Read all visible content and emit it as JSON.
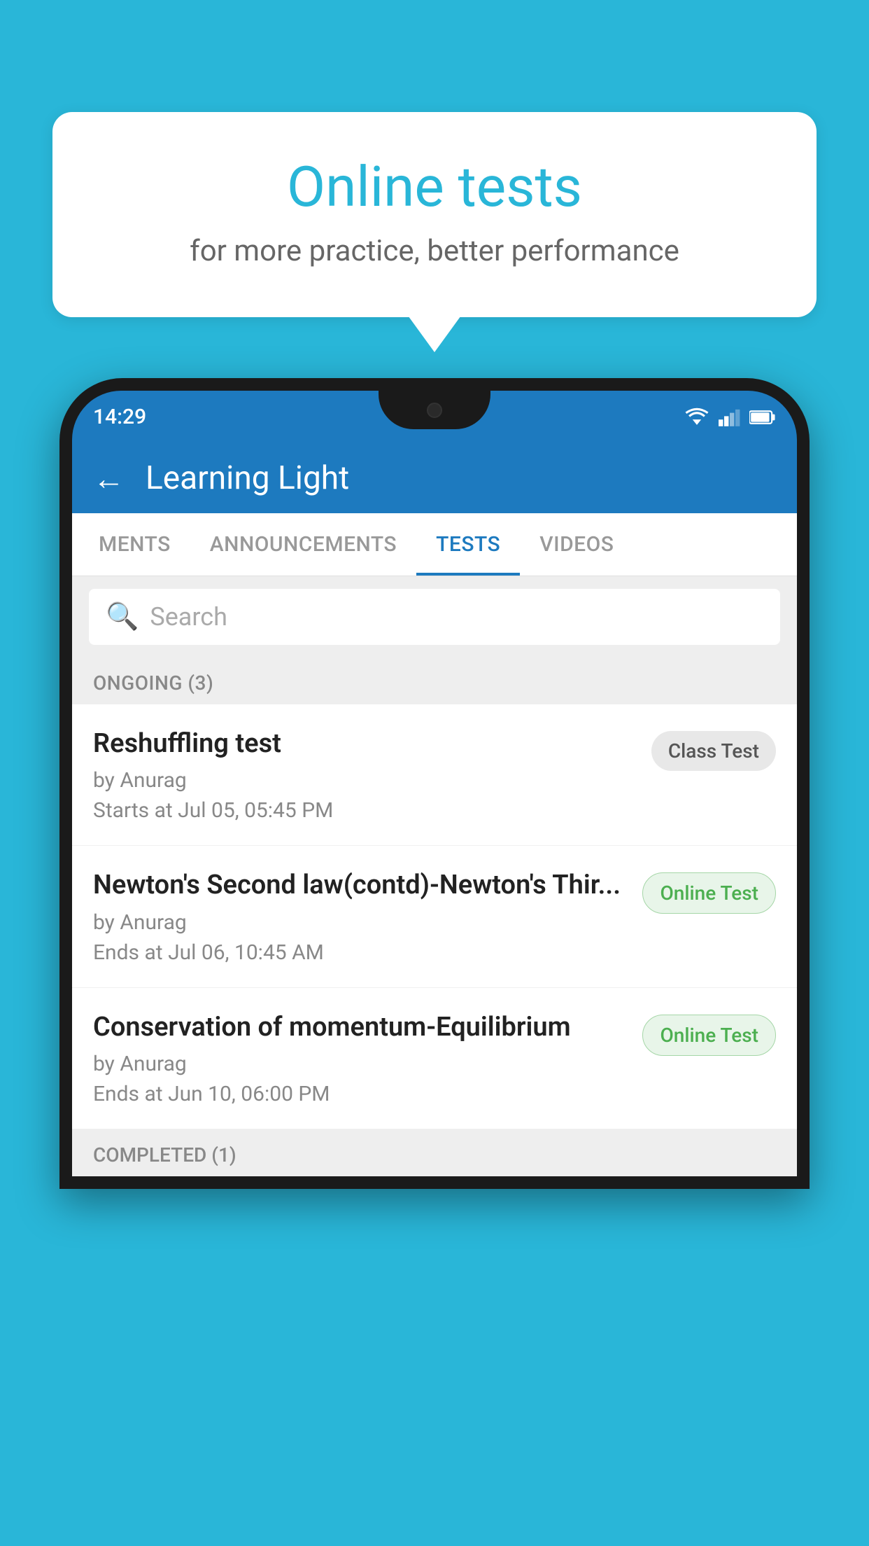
{
  "background_color": "#29b6d8",
  "bubble": {
    "title": "Online tests",
    "subtitle": "for more practice, better performance"
  },
  "phone": {
    "status_bar": {
      "time": "14:29",
      "signal_icon": "signal",
      "battery_icon": "battery"
    },
    "header": {
      "back_label": "←",
      "title": "Learning Light"
    },
    "tabs": [
      {
        "label": "MENTS",
        "active": false
      },
      {
        "label": "ANNOUNCEMENTS",
        "active": false
      },
      {
        "label": "TESTS",
        "active": true
      },
      {
        "label": "VIDEOS",
        "active": false
      }
    ],
    "search": {
      "placeholder": "Search"
    },
    "section_ongoing": {
      "label": "ONGOING (3)"
    },
    "tests": [
      {
        "name": "Reshuffling test",
        "author": "by Anurag",
        "time_label": "Starts at",
        "time": "Jul 05, 05:45 PM",
        "badge": "Class Test",
        "badge_type": "class"
      },
      {
        "name": "Newton's Second law(contd)-Newton's Thir...",
        "author": "by Anurag",
        "time_label": "Ends at",
        "time": "Jul 06, 10:45 AM",
        "badge": "Online Test",
        "badge_type": "online"
      },
      {
        "name": "Conservation of momentum-Equilibrium",
        "author": "by Anurag",
        "time_label": "Ends at",
        "time": "Jun 10, 06:00 PM",
        "badge": "Online Test",
        "badge_type": "online"
      }
    ],
    "section_completed": {
      "label": "COMPLETED (1)"
    }
  }
}
